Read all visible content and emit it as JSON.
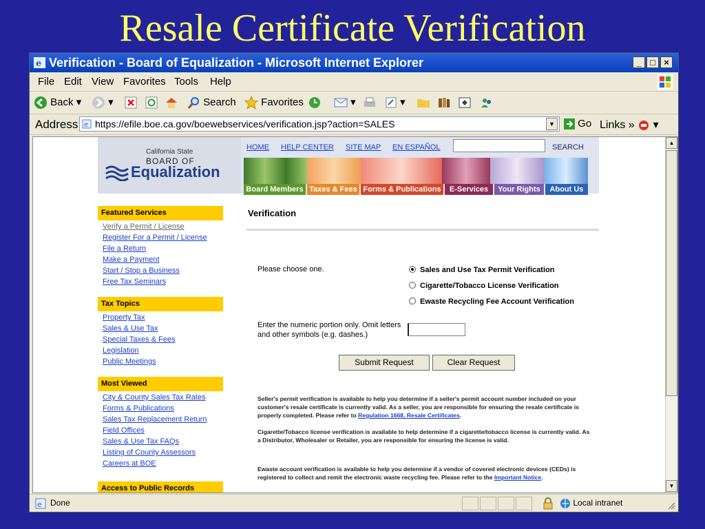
{
  "slide": {
    "title": "Resale Certificate Verification"
  },
  "window": {
    "title": "Verification - Board of Equalization - Microsoft Internet Explorer",
    "min": "_",
    "max": "□",
    "close": "×"
  },
  "menu": [
    "File",
    "Edit",
    "View",
    "Favorites",
    "Tools",
    "Help"
  ],
  "toolbar": {
    "back": "Back",
    "search": "Search",
    "favorites": "Favorites"
  },
  "address": {
    "label": "Address",
    "url": "https://efile.boe.ca.gov/boewebservices/verification.jsp?action=SALES",
    "go": "Go",
    "links": "Links"
  },
  "site": {
    "logo": {
      "small": "California State",
      "mid": "BOARD OF",
      "big": "Equalization"
    },
    "top_links": [
      "HOME",
      "HELP CENTER",
      "SITE MAP",
      "EN ESPAÑOL"
    ],
    "search_label": "SEARCH",
    "tabs": [
      {
        "label": "Board Members",
        "color": "#5a9a2e"
      },
      {
        "label": "Taxes & Fees",
        "color": "#e58a2b"
      },
      {
        "label": "Forms & Publications",
        "color": "#d2492c"
      },
      {
        "label": "E-Services",
        "color": "#8e2a55"
      },
      {
        "label": "Your Rights",
        "color": "#7b5ca8"
      },
      {
        "label": "About Us",
        "color": "#2a62b5"
      }
    ]
  },
  "sidebar": {
    "featured": {
      "title": "Featured Services",
      "links": [
        "Verify a Permit / License",
        "Register For a Permit / License",
        "File a Return",
        "Make a Payment",
        "Start / Stop a Business",
        "Free Tax Seminars"
      ]
    },
    "topics": {
      "title": "Tax Topics",
      "links": [
        "Property Tax",
        "Sales & Use Tax",
        "Special Taxes & Fees",
        "Legislation",
        "Public Meetings"
      ]
    },
    "viewed": {
      "title": "Most Viewed",
      "links": [
        "City & County Sales Tax Rates",
        "Forms & Publications",
        "Sales Tax Replacement Return",
        "Field Offices",
        "Sales & Use Tax FAQs",
        "Listing of County Assessors",
        "Careers at BOE"
      ]
    },
    "records": {
      "title": "Access to Public Records"
    }
  },
  "form": {
    "heading": "Verification",
    "choose": "Please choose one.",
    "options": [
      "Sales and Use Tax Permit Verification",
      "Cigarette/Tobacco License Verification",
      "Ewaste Recycling Fee Account Verification"
    ],
    "selected_option": "Sales and Use Tax Permit Verification",
    "hint": "Enter the numeric portion only. Omit letters and other symbols (e.g. dashes.)",
    "number_value": "",
    "submit": "Submit Request",
    "clear": "Clear Request"
  },
  "notes": {
    "seller_text": "Seller's permit verification is available to help you determine if a seller's permit account number included on your customer's resale certificate is currently valid. As a seller, you are responsible for ensuring the resale certificate is properly completed. Please refer to",
    "seller_link": "Regulation 1668, Resale Certificates",
    "seller_end": ".",
    "cig_text": "Cigarette/Tobacco license verification is available to help determine if a cigarette/tobacco license is currently valid. As a Distributor, Wholesaler or Retailer, you are responsible for ensuring the license is valid.",
    "ewaste_text": "Ewaste account verification is available to help you determine if a vendor of covered electronic devices (CEDs) is registered to collect and remit the electronic waste recycling fee. Please refer to the",
    "ewaste_link": "Important Notice",
    "ewaste_end": "."
  },
  "status": {
    "text": "Done",
    "zone": "Local intranet"
  }
}
